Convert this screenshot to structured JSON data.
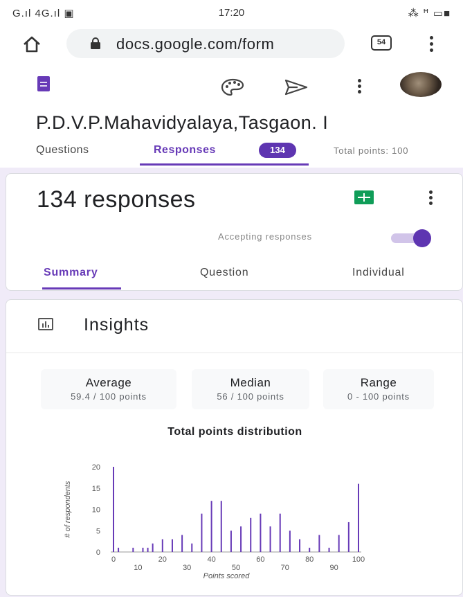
{
  "status_bar": {
    "left": "G.ıl 4G.ıl ▣",
    "time": "17:20",
    "right": "⁂ ꟸ ▭■"
  },
  "browser": {
    "url": "docs.google.com/form",
    "tab_count": "54"
  },
  "form": {
    "title": "P.D.V.P.Mahavidyalaya,Tasgaon. I",
    "tabs": {
      "questions": "Questions",
      "responses": "Responses",
      "responses_badge": "134",
      "total_points": "Total points: 100"
    }
  },
  "responses_card": {
    "count_label": "134 responses",
    "accepting_label": "Accepting responses",
    "accepting_on": true,
    "subtabs": [
      "Summary",
      "Question",
      "Individual"
    ]
  },
  "insights": {
    "title": "Insights",
    "stats": [
      {
        "label": "Average",
        "value": "59.4 / 100 points"
      },
      {
        "label": "Median",
        "value": "56 / 100 points"
      },
      {
        "label": "Range",
        "value": "0 - 100 points"
      }
    ]
  },
  "chart_data": {
    "type": "bar",
    "title": "Total points distribution",
    "xlabel": "Points scored",
    "ylabel": "# of respondents",
    "x_ticks_top": [
      0,
      20,
      40,
      60,
      80,
      100
    ],
    "x_ticks_bottom": [
      10,
      30,
      50,
      70,
      90
    ],
    "y_ticks": [
      0,
      5,
      10,
      15,
      20
    ],
    "ylim": [
      0,
      20
    ],
    "xlim": [
      0,
      100
    ],
    "bar_color": "#673ab7",
    "points": [
      {
        "x": 0,
        "y": 20
      },
      {
        "x": 2,
        "y": 1
      },
      {
        "x": 8,
        "y": 1
      },
      {
        "x": 12,
        "y": 1
      },
      {
        "x": 14,
        "y": 1
      },
      {
        "x": 16,
        "y": 2
      },
      {
        "x": 20,
        "y": 3
      },
      {
        "x": 24,
        "y": 3
      },
      {
        "x": 28,
        "y": 4
      },
      {
        "x": 32,
        "y": 2
      },
      {
        "x": 36,
        "y": 9
      },
      {
        "x": 40,
        "y": 12
      },
      {
        "x": 44,
        "y": 12
      },
      {
        "x": 48,
        "y": 5
      },
      {
        "x": 52,
        "y": 6
      },
      {
        "x": 56,
        "y": 8
      },
      {
        "x": 60,
        "y": 9
      },
      {
        "x": 64,
        "y": 6
      },
      {
        "x": 68,
        "y": 9
      },
      {
        "x": 72,
        "y": 5
      },
      {
        "x": 76,
        "y": 3
      },
      {
        "x": 80,
        "y": 1
      },
      {
        "x": 84,
        "y": 4
      },
      {
        "x": 88,
        "y": 1
      },
      {
        "x": 92,
        "y": 4
      },
      {
        "x": 96,
        "y": 7
      },
      {
        "x": 100,
        "y": 16
      }
    ]
  }
}
